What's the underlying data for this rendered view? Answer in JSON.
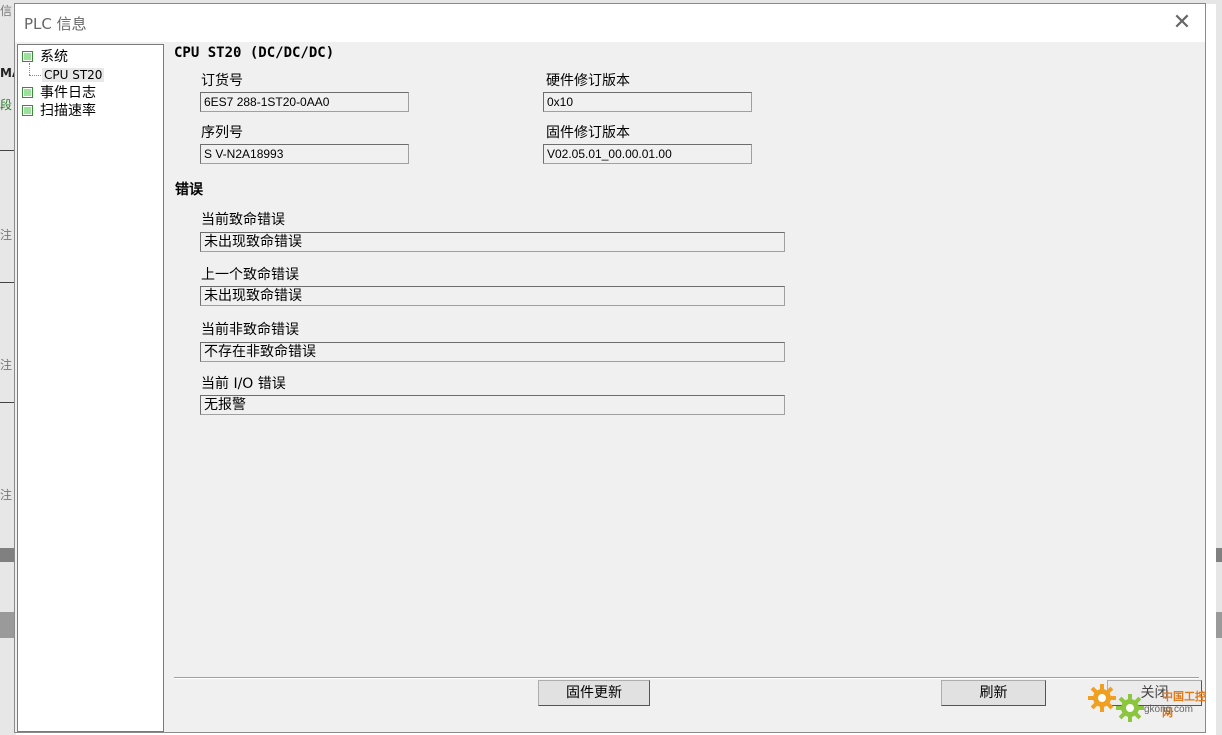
{
  "dialog": {
    "title": "PLC 信息",
    "close_glyph": "✕"
  },
  "tree": {
    "items": [
      {
        "label": "系统"
      },
      {
        "label": "CPU ST20"
      },
      {
        "label": "事件日志"
      },
      {
        "label": "扫描速率"
      }
    ]
  },
  "system": {
    "cpu_title": "CPU ST20 (DC/DC/DC)",
    "order_number_label": "订货号",
    "order_number": "6ES7 288-1ST20-0AA0",
    "hardware_rev_label": "硬件修订版本",
    "hardware_rev": "0x10",
    "serial_label": "序列号",
    "serial": "S V-N2A18993",
    "firmware_rev_label": "固件修订版本",
    "firmware_rev": "V02.05.01_00.00.01.00"
  },
  "errors": {
    "section_title": "错误",
    "current_fatal_label": "当前致命错误",
    "current_fatal": "未出现致命错误",
    "last_fatal_label": "上一个致命错误",
    "last_fatal": "未出现致命错误",
    "current_nonfatal_label": "当前非致命错误",
    "current_nonfatal": "不存在非致命错误",
    "current_io_label": "当前 I/O 错误",
    "current_io": "无报警"
  },
  "buttons": {
    "firmware_update": "固件更新",
    "refresh": "刷新",
    "close": "关闭"
  },
  "watermark": {
    "brand": "中国工控网",
    "domain": "gkong.com"
  },
  "background_app": {
    "fragments": [
      "信",
      "MA",
      "段",
      "注",
      "注",
      "注"
    ]
  },
  "colors": {
    "tree_node_fill": "#9be09b",
    "tree_node_border": "#3c8c3c",
    "dialog_bg": "#f0f0f0"
  }
}
